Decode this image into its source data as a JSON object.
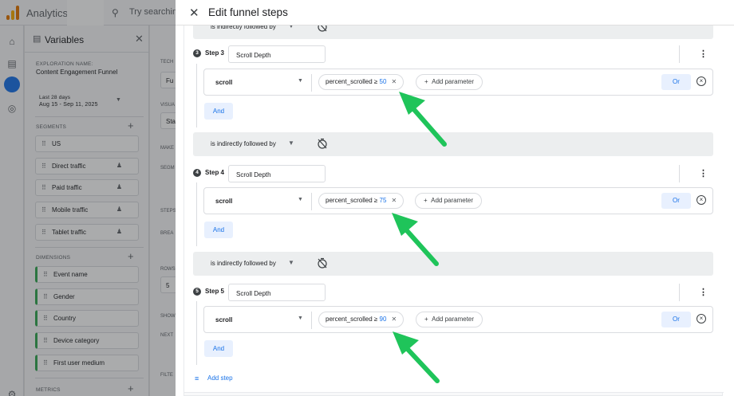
{
  "app": {
    "name": "Analytics",
    "search_placeholder": "Try searching"
  },
  "variables_panel": {
    "title": "Variables",
    "exploration_label": "EXPLORATION NAME:",
    "exploration_name": "Content Engagement Funnel",
    "date_label": "Last 28 days",
    "date_range": "Aug 15 - Sep 11, 2025",
    "segments_label": "SEGMENTS",
    "segments": [
      "US",
      "Direct traffic",
      "Paid traffic",
      "Mobile traffic",
      "Tablet traffic"
    ],
    "dimensions_label": "DIMENSIONS",
    "dimensions": [
      "Event name",
      "Gender",
      "Country",
      "Device category",
      "First user medium"
    ],
    "metrics_label": "METRICS"
  },
  "settings_panel": {
    "labels": [
      "TECH",
      "VISUA",
      "MAKE",
      "SEGM",
      "STEPS",
      "BREA",
      "ROWS",
      "SHOW",
      "NEXT",
      "FILTE"
    ],
    "values": [
      "Fu",
      "Sta",
      "5"
    ]
  },
  "dialog": {
    "title": "Edit funnel steps",
    "connector_text": "is indirectly followed by",
    "add_step_label": "Add step",
    "steps": [
      {
        "number": "3",
        "label": "Step 3",
        "name": "Scroll Depth",
        "event": "scroll",
        "param_name": "percent_scrolled ≥ ",
        "param_value": "50",
        "add_param_label": "Add parameter",
        "or_label": "Or",
        "and_label": "And"
      },
      {
        "number": "4",
        "label": "Step 4",
        "name": "Scroll Depth",
        "event": "scroll",
        "param_name": "percent_scrolled ≥ ",
        "param_value": "75",
        "add_param_label": "Add parameter",
        "or_label": "Or",
        "and_label": "And"
      },
      {
        "number": "5",
        "label": "Step 5",
        "name": "Scroll Depth",
        "event": "scroll",
        "param_name": "percent_scrolled ≥ ",
        "param_value": "90",
        "add_param_label": "Add parameter",
        "or_label": "Or",
        "and_label": "And"
      }
    ]
  },
  "colors": {
    "accent": "#1a73e8",
    "annotation_arrow": "#1fc45a",
    "segment_bar": "#34a853"
  }
}
